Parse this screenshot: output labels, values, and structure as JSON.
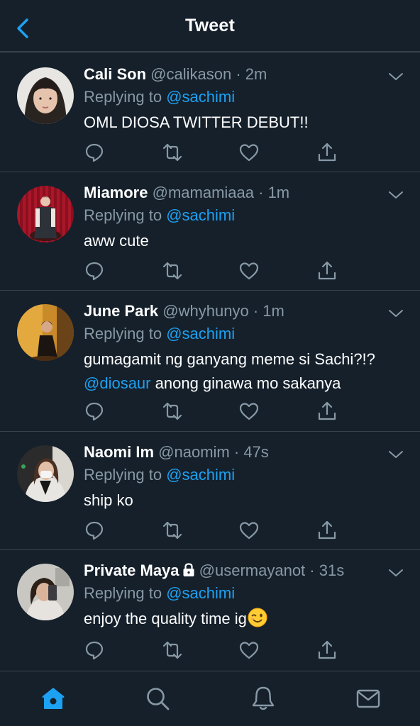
{
  "header": {
    "title": "Tweet",
    "back_icon": "chevron-left-icon"
  },
  "colors": {
    "background": "#15202b",
    "divider": "#38444d",
    "secondary_text": "#8899a6",
    "accent": "#1da1f2"
  },
  "tweets": [
    {
      "name": "Cali Son",
      "handle": "@calikason",
      "time": "2m",
      "replying_prefix": "Replying to",
      "replying_to": "@sachimi",
      "text": "OML DIOSA TWITTER DEBUT!!"
    },
    {
      "name": "Miamore",
      "handle": "@mamamiaaa",
      "time": "1m",
      "replying_prefix": "Replying to",
      "replying_to": "@sachimi",
      "text": "aww cute"
    },
    {
      "name": "June Park",
      "handle": "@whyhunyo",
      "time": "1m",
      "replying_prefix": "Replying to",
      "replying_to": "@sachimi",
      "text_line1": "gumagamit ng ganyang meme si Sachi?!?",
      "text_mention": "@diosaur",
      "text_line2_rest": "anong ginawa mo sakanya"
    },
    {
      "name": "Naomi Im",
      "handle": "@naomim",
      "time": "47s",
      "replying_prefix": "Replying to",
      "replying_to": "@sachimi",
      "text": "ship ko"
    },
    {
      "name": "Private Maya",
      "handle": "@usermayanot",
      "time": "31s",
      "replying_prefix": "Replying to",
      "replying_to": "@sachimi",
      "text": "enjoy the quality time ig",
      "emoji": "winking-face-emoji",
      "protected": true
    }
  ],
  "tab_bar": {
    "tabs": [
      "home-icon",
      "search-icon",
      "notifications-icon",
      "messages-icon"
    ],
    "active": "home-icon"
  }
}
